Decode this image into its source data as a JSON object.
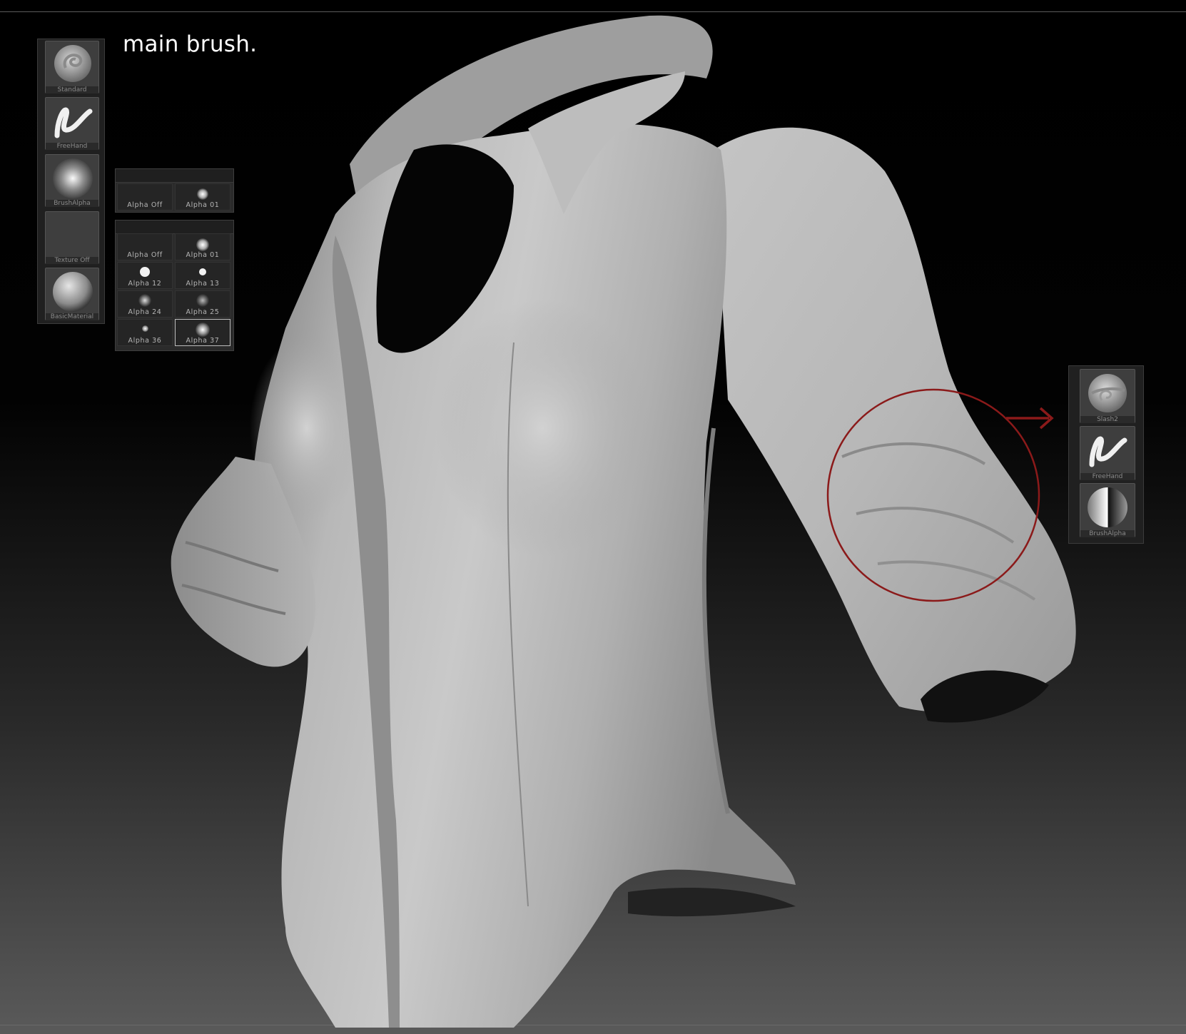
{
  "caption": "main brush.",
  "left_shelf": [
    {
      "label": "Standard",
      "icon": "standard-brush-icon"
    },
    {
      "label": "FreeHand",
      "icon": "freehand-stroke-icon"
    },
    {
      "label": "BrushAlpha",
      "icon": "brush-alpha-icon"
    },
    {
      "label": "Texture Off",
      "icon": "texture-off-icon"
    },
    {
      "label": "BasicMaterial",
      "icon": "material-sphere-icon"
    }
  ],
  "alpha_popup_small": [
    {
      "label": "Alpha Off"
    },
    {
      "label": "Alpha 01"
    }
  ],
  "alpha_popup_large": [
    {
      "label": "Alpha Off"
    },
    {
      "label": "Alpha 01"
    },
    {
      "label": "Alpha 12"
    },
    {
      "label": "Alpha 13"
    },
    {
      "label": "Alpha 24"
    },
    {
      "label": "Alpha 25"
    },
    {
      "label": "Alpha 36"
    },
    {
      "label": "Alpha 37"
    }
  ],
  "right_shelf": [
    {
      "label": "Slash2",
      "icon": "slash-brush-icon"
    },
    {
      "label": "FreeHand",
      "icon": "freehand-stroke-icon"
    },
    {
      "label": "BrushAlpha",
      "icon": "half-alpha-icon"
    }
  ],
  "annotation_color": "#8b1a1a"
}
